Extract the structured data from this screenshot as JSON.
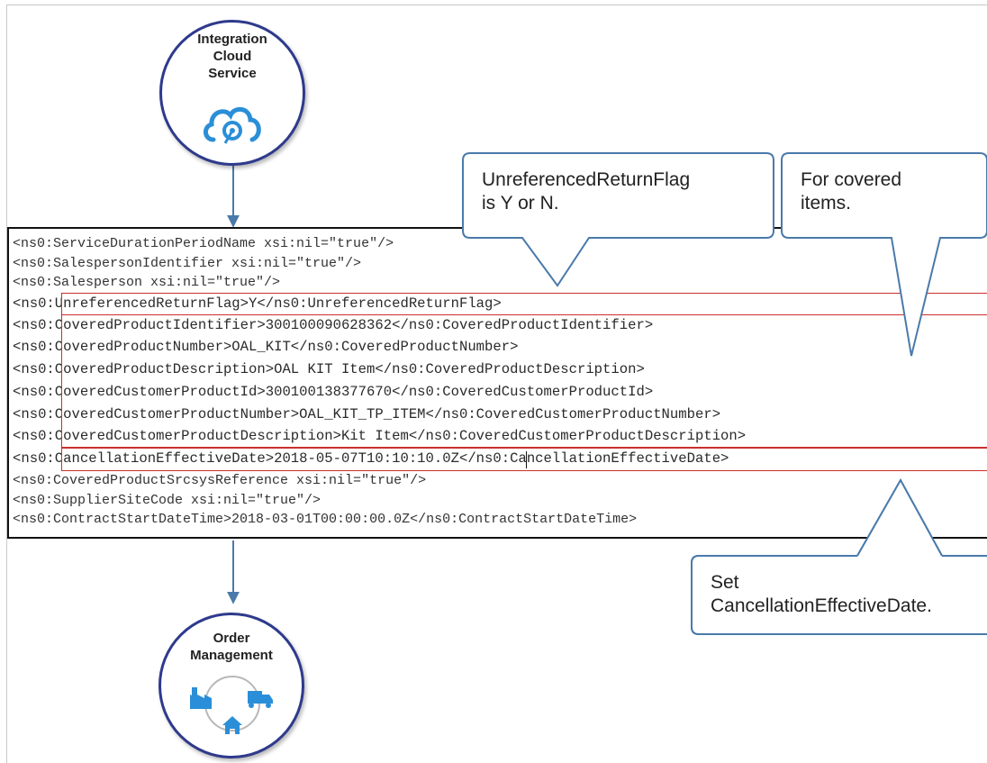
{
  "top_node": {
    "title": "Integration\nCloud\nService",
    "icon": "cloud-icon"
  },
  "bottom_node": {
    "title": "Order\nManagement",
    "icon": "order-management-icon"
  },
  "code_lines": [
    "<ns0:ServiceDurationPeriodName xsi:nil=\"true\"/>",
    "<ns0:SalespersonIdentifier xsi:nil=\"true\"/>",
    "<ns0:Salesperson xsi:nil=\"true\"/>",
    "<ns0:UnreferencedReturnFlag>Y</ns0:UnreferencedReturnFlag>",
    "<ns0:CoveredProductIdentifier>300100090628362</ns0:CoveredProductIdentifier>",
    "<ns0:CoveredProductNumber>OAL_KIT</ns0:CoveredProductNumber>",
    "<ns0:CoveredProductDescription>OAL KIT Item</ns0:CoveredProductDescription>",
    "<ns0:CoveredCustomerProductId>300100138377670</ns0:CoveredCustomerProductId>",
    "<ns0:CoveredCustomerProductNumber>OAL_KIT_TP_ITEM</ns0:CoveredCustomerProductNumber>",
    "<ns0:CoveredCustomerProductDescription>Kit Item</ns0:CoveredCustomerProductDescription>",
    "<ns0:CancellationEffectiveDate>2018-05-07T10:10:10.0Z</ns0:CancellationEffectiveDate>",
    "<ns0:CoveredProductSrcsysReference xsi:nil=\"true\"/>",
    "<ns0:SupplierSiteCode xsi:nil=\"true\"/>",
    "<ns0:ContractStartDateTime>2018-03-01T00:00:00.0Z</ns0:ContractStartDateTime>"
  ],
  "callouts": {
    "return_flag": "UnreferencedReturnFlag\nis Y or N.",
    "covered_items": "For covered\nitems.",
    "cancellation": "Set\nCancellationEffectiveDate."
  },
  "colors": {
    "circle_border": "#2e3a8c",
    "arrow": "#4a7aaa",
    "highlight_border": "#c9302c",
    "callout_border": "#4a7aaa",
    "icon_blue": "#2a8fd8"
  }
}
